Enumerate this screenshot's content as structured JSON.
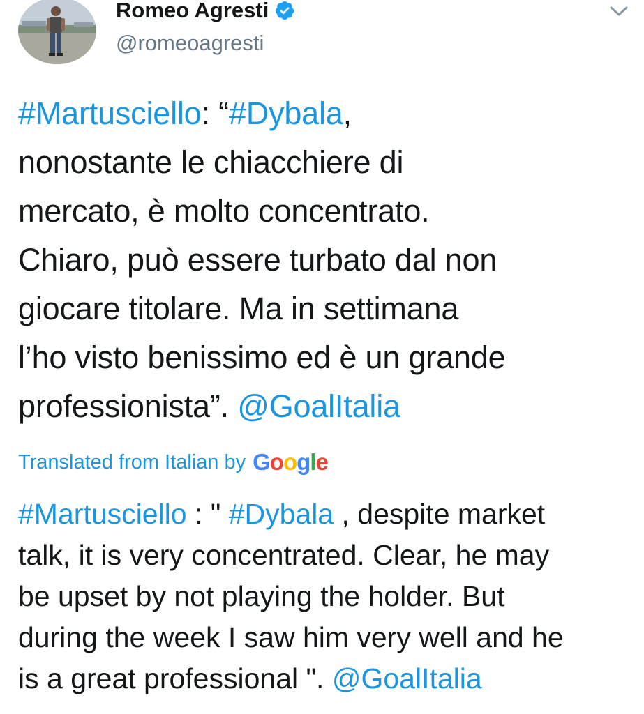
{
  "author": {
    "display_name": "Romeo Agresti",
    "handle": "@romeoagresti",
    "verified": true
  },
  "tweet": {
    "lines": [
      [
        {
          "text": "#Martusciello",
          "link": true
        },
        {
          "text": ": “",
          "link": false
        },
        {
          "text": "#Dybala",
          "link": true
        },
        {
          "text": ",",
          "link": false
        }
      ],
      [
        {
          "text": "nonostante le chiacchiere di",
          "link": false
        }
      ],
      [
        {
          "text": "mercato, è molto concentrato.",
          "link": false
        }
      ],
      [
        {
          "text": "Chiaro, può essere turbato dal non",
          "link": false
        }
      ],
      [
        {
          "text": "giocare titolare. Ma in settimana",
          "link": false
        }
      ],
      [
        {
          "text": "l’ho visto benissimo ed è un grande",
          "link": false
        }
      ],
      [
        {
          "text": "professionista”. ",
          "link": false
        },
        {
          "text": "@GoalItalia",
          "link": true
        }
      ]
    ]
  },
  "translation_bar": {
    "label": "Translated from Italian by",
    "provider": "Google",
    "provider_colors": [
      "#4285F4",
      "#EA4335",
      "#FBBC05",
      "#4285F4",
      "#34A853",
      "#EA4335"
    ]
  },
  "translation": {
    "lines": [
      [
        {
          "text": "#Martusciello",
          "link": true
        },
        {
          "text": " : \" ",
          "link": false
        },
        {
          "text": "#Dybala",
          "link": true
        },
        {
          "text": " , despite market",
          "link": false
        }
      ],
      [
        {
          "text": "talk, it is very concentrated. Clear, he may",
          "link": false
        }
      ],
      [
        {
          "text": "be upset by not playing the holder. But",
          "link": false
        }
      ],
      [
        {
          "text": "during the week I saw him very well and he",
          "link": false
        }
      ],
      [
        {
          "text": "is a great professional \". ",
          "link": false
        },
        {
          "text": "@GoalItalia",
          "link": true
        }
      ]
    ]
  },
  "icons": {
    "verified": "verified-badge-icon",
    "caret": "chevron-down-icon"
  },
  "colors": {
    "link": "#1b95e0",
    "text": "#14171a",
    "secondary": "#657786",
    "verified": "#1da1f2"
  }
}
